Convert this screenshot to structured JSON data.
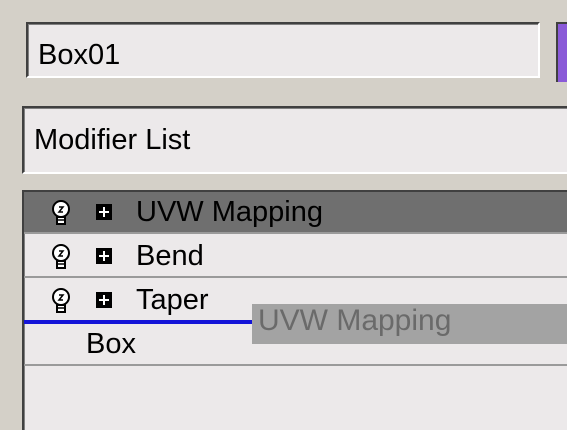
{
  "object_name": {
    "value": "Box01"
  },
  "modifier_list": {
    "label": "Modifier List"
  },
  "colors": {
    "swatch": "#8a5ad8",
    "selected_row": "#6f6f6f",
    "drop_line": "#1414d8"
  },
  "stack": {
    "items": [
      {
        "label": "UVW Mapping",
        "icon": "lightbulb-icon",
        "expand_icon": "plus-icon",
        "selected": true
      },
      {
        "label": "Bend",
        "icon": "lightbulb-icon",
        "expand_icon": "plus-icon",
        "selected": false
      },
      {
        "label": "Taper",
        "icon": "lightbulb-icon",
        "expand_icon": "plus-icon",
        "selected": false
      }
    ],
    "base": {
      "label": "Box"
    }
  },
  "drag": {
    "label": "UVW Mapping"
  }
}
